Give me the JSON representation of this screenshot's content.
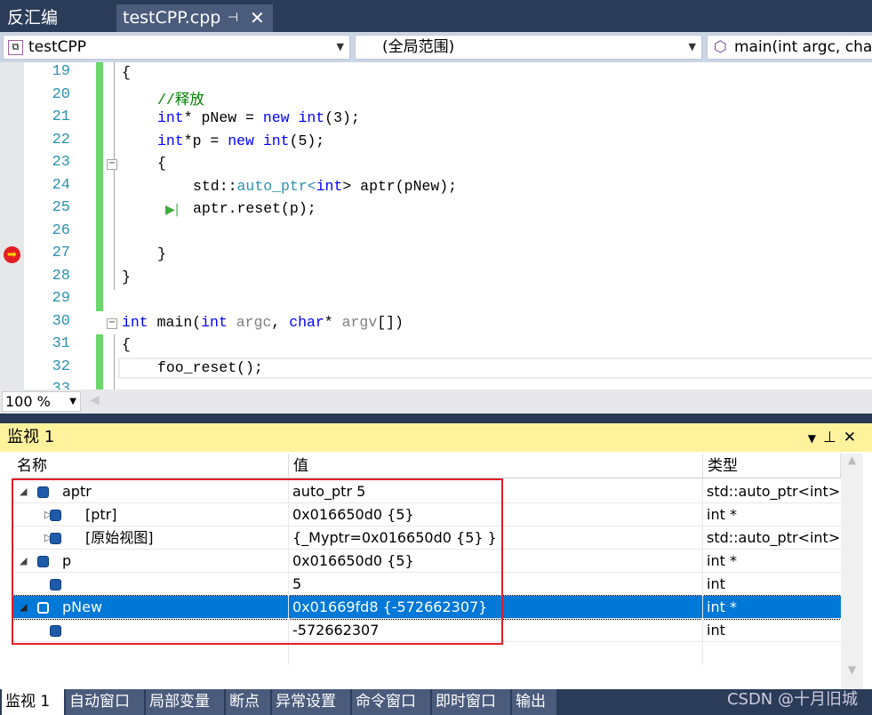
{
  "tabs": [
    {
      "label": "反汇编"
    },
    {
      "label": "testCPP.cpp",
      "pin": "⊣",
      "close": "✕"
    }
  ],
  "nav": {
    "project": "testCPP",
    "scope": "(全局范围)",
    "function": "main(int argc, char"
  },
  "code": {
    "lines": [
      {
        "n": "19",
        "indent": 0,
        "seg": [
          [
            "{",
            ""
          ]
        ]
      },
      {
        "n": "20",
        "indent": 1,
        "seg": [
          [
            "//释放",
            "cm"
          ]
        ]
      },
      {
        "n": "21",
        "indent": 1,
        "seg": [
          [
            "int",
            "kw"
          ],
          [
            "* pNew = ",
            ""
          ],
          [
            "new",
            "kw"
          ],
          [
            " ",
            ""
          ],
          [
            "int",
            "kw"
          ],
          [
            "(3);",
            ""
          ]
        ]
      },
      {
        "n": "22",
        "indent": 1,
        "seg": [
          [
            "int",
            "kw"
          ],
          [
            "*p = ",
            ""
          ],
          [
            "new",
            "kw"
          ],
          [
            " ",
            ""
          ],
          [
            "int",
            "kw"
          ],
          [
            "(5);",
            ""
          ]
        ]
      },
      {
        "n": "23",
        "indent": 1,
        "seg": [
          [
            "{",
            ""
          ]
        ]
      },
      {
        "n": "24",
        "indent": 2,
        "seg": [
          [
            "std::",
            ""
          ],
          [
            "auto_ptr",
            "ty"
          ],
          [
            "<",
            "ty"
          ],
          [
            "int",
            "kw"
          ],
          [
            "> aptr(pNew);",
            ""
          ]
        ]
      },
      {
        "n": "25",
        "indent": 2,
        "seg": [
          [
            "aptr.reset(p);",
            ""
          ]
        ]
      },
      {
        "n": "26",
        "indent": 2,
        "seg": []
      },
      {
        "n": "27",
        "indent": 1,
        "seg": [
          [
            "}",
            ""
          ]
        ]
      },
      {
        "n": "28",
        "indent": 0,
        "seg": [
          [
            "}",
            ""
          ]
        ]
      },
      {
        "n": "29",
        "indent": 0,
        "seg": []
      },
      {
        "n": "30",
        "indent": 0,
        "seg": [
          [
            "int",
            "kw"
          ],
          [
            " main(",
            ""
          ],
          [
            "int",
            "kw"
          ],
          [
            " ",
            ""
          ],
          [
            "argc",
            "pa"
          ],
          [
            ", ",
            ""
          ],
          [
            "char",
            "kw"
          ],
          [
            "* ",
            ""
          ],
          [
            "argv",
            "pa"
          ],
          [
            "[])",
            ""
          ]
        ]
      },
      {
        "n": "31",
        "indent": 0,
        "seg": [
          [
            "{",
            ""
          ]
        ]
      },
      {
        "n": "32",
        "indent": 1,
        "seg": [
          [
            "foo_reset();",
            ""
          ]
        ]
      },
      {
        "n": "33",
        "indent": 0,
        "seg": []
      }
    ]
  },
  "zoom": "100 %",
  "watch": {
    "title": "监视 1",
    "headers": {
      "name": "名称",
      "value": "值",
      "type": "类型"
    },
    "rows": [
      {
        "level": 0,
        "expander": "expanded",
        "name": "aptr",
        "value": "auto_ptr 5",
        "type": "std::auto_ptr<int>"
      },
      {
        "level": 1,
        "expander": "collapsed",
        "name": "[ptr]",
        "value": "0x016650d0 {5}",
        "type": "int *"
      },
      {
        "level": 1,
        "expander": "collapsed",
        "name": "[原始视图]",
        "value": "{_Myptr=0x016650d0 {5} }",
        "type": "std::auto_ptr<int>"
      },
      {
        "level": 0,
        "expander": "expanded",
        "name": "p",
        "value": "0x016650d0 {5}",
        "type": "int *"
      },
      {
        "level": 1,
        "expander": "none",
        "name": "",
        "value": "5",
        "type": "int"
      },
      {
        "level": 0,
        "expander": "expanded",
        "name": "pNew",
        "value": "0x01669fd8 {-572662307}",
        "type": "int *",
        "selected": true
      },
      {
        "level": 1,
        "expander": "none",
        "name": "",
        "value": "-572662307",
        "type": "int"
      }
    ]
  },
  "bottom_tabs": [
    "监视 1",
    "自动窗口",
    "局部变量",
    "断点",
    "异常设置",
    "命令窗口",
    "即时窗口",
    "输出"
  ],
  "watermark": "CSDN @十月旧城",
  "colors": {
    "selection": "#0078d7",
    "highlight_box": "#e0202a",
    "title_bar": "#fff29d"
  }
}
